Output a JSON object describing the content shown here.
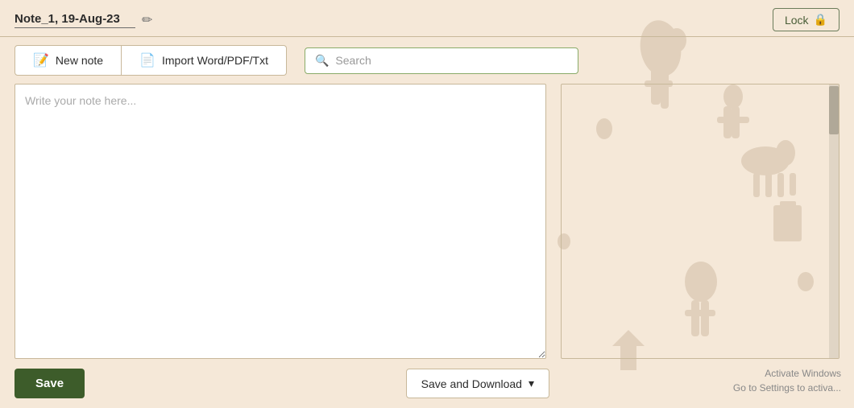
{
  "header": {
    "note_title": "Note_1, 19-Aug-23",
    "lock_label": "Lock",
    "edit_icon": "✏"
  },
  "toolbar": {
    "new_note_label": "New note",
    "import_label": "Import Word/PDF/Txt",
    "search_placeholder": "Search"
  },
  "editor": {
    "placeholder": "Write your note here..."
  },
  "footer": {
    "save_label": "Save",
    "save_download_label": "Save and Download",
    "chevron_icon": "▾"
  },
  "watermark": {
    "line1": "Activate Windows",
    "line2": "Go to Settings to activa..."
  }
}
